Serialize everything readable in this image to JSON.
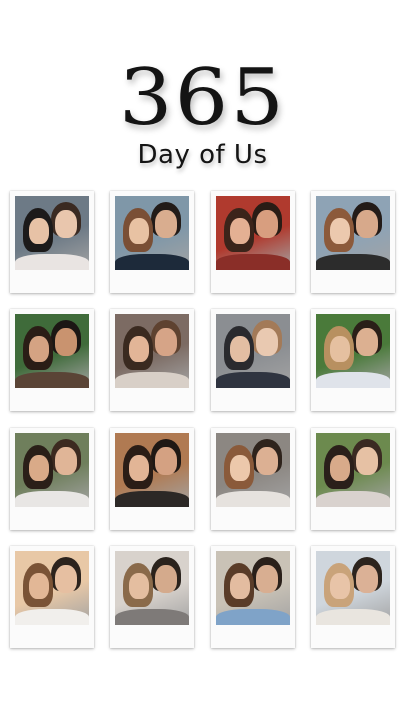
{
  "title": {
    "number": "365",
    "subtitle": "Day of Us"
  },
  "photos": [
    {
      "name": "couple-photo-01",
      "bg": "#6d7a86",
      "skin1": "#e7c2a6",
      "skin2": "#e9c6ad",
      "hair1": "#1c1a1a",
      "hair2": "#3a2a22",
      "shirt": "#e9e4e2"
    },
    {
      "name": "couple-photo-02",
      "bg": "#7f97a8",
      "skin1": "#e8c2a3",
      "skin2": "#d9ad8f",
      "hair1": "#7a4f35",
      "hair2": "#221b18",
      "shirt": "#1d2a3a"
    },
    {
      "name": "couple-photo-03",
      "bg": "#b03a2e",
      "skin1": "#e4b093",
      "skin2": "#d89e7f",
      "hair1": "#3b241a",
      "hair2": "#2a1c15",
      "shirt": "#8a2e28"
    },
    {
      "name": "couple-photo-04",
      "bg": "#8ea3b5",
      "skin1": "#ecc9ae",
      "skin2": "#d7a98b",
      "hair1": "#8c5a3b",
      "hair2": "#231b18",
      "shirt": "#2c2c2c"
    },
    {
      "name": "couple-photo-05",
      "bg": "#3f6b3a",
      "skin1": "#d4a383",
      "skin2": "#c9936f",
      "hair1": "#2a1d16",
      "hair2": "#1c1714",
      "shirt": "#5a4436"
    },
    {
      "name": "couple-photo-06",
      "bg": "#7c6b63",
      "skin1": "#e2b597",
      "skin2": "#d6a487",
      "hair1": "#3a2a20",
      "hair2": "#5e4230",
      "shirt": "#d8cfc7"
    },
    {
      "name": "couple-photo-07",
      "bg": "#8b8e92",
      "skin1": "#e3bea3",
      "skin2": "#e9c9b1",
      "hair1": "#2a2a2e",
      "hair2": "#a37a58",
      "shirt": "#2f3440"
    },
    {
      "name": "couple-photo-08",
      "bg": "#4a7a3a",
      "skin1": "#e5c0a0",
      "skin2": "#dcb091",
      "hair1": "#b89060",
      "hair2": "#2a1f18",
      "shirt": "#dfe3ea"
    },
    {
      "name": "couple-photo-09",
      "bg": "#6f7f5c",
      "skin1": "#d9aa88",
      "skin2": "#e0b597",
      "hair1": "#2a1f18",
      "hair2": "#3c2a20",
      "shirt": "#e8e6e4"
    },
    {
      "name": "couple-photo-10",
      "bg": "#b07a52",
      "skin1": "#e2b596",
      "skin2": "#d4a182",
      "hair1": "#2a1d16",
      "hair2": "#1f1814",
      "shirt": "#2c2826"
    },
    {
      "name": "couple-photo-11",
      "bg": "#8c8782",
      "skin1": "#ecc8ab",
      "skin2": "#dcb093",
      "hair1": "#8a5a3a",
      "hair2": "#2e231c",
      "shirt": "#e6e2de"
    },
    {
      "name": "couple-photo-12",
      "bg": "#6c8a4e",
      "skin1": "#d8aa8a",
      "skin2": "#e6c1a4",
      "hair1": "#2a1f1a",
      "hair2": "#3a2a22",
      "shirt": "#d9d2ce"
    },
    {
      "name": "couple-photo-13",
      "bg": "#e8c8a6",
      "skin1": "#e2b796",
      "skin2": "#e6bfa1",
      "hair1": "#7a5336",
      "hair2": "#2c231d",
      "shirt": "#f1efec"
    },
    {
      "name": "couple-photo-14",
      "bg": "#d8d2cc",
      "skin1": "#e4bea0",
      "skin2": "#d4aa8c",
      "hair1": "#8a6a4a",
      "hair2": "#2a221c",
      "shirt": "#7e7a78"
    },
    {
      "name": "couple-photo-15",
      "bg": "#c9c2b6",
      "skin1": "#e3bca0",
      "skin2": "#d8ae91",
      "hair1": "#5a3c28",
      "hair2": "#2a201a",
      "shirt": "#7fa3c8"
    },
    {
      "name": "couple-photo-16",
      "bg": "#cfd6dd",
      "skin1": "#e8c4a8",
      "skin2": "#dbb196",
      "hair1": "#c9a37a",
      "hair2": "#2c241e",
      "shirt": "#e9e5df"
    }
  ]
}
